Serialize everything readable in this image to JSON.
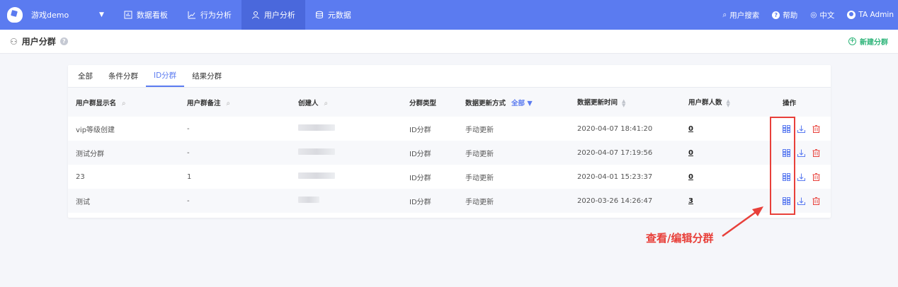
{
  "topbar": {
    "project": "游戏demo",
    "nav": [
      {
        "label": "数据看板",
        "icon": "dashboard-icon"
      },
      {
        "label": "行为分析",
        "icon": "trend-icon"
      },
      {
        "label": "用户分析",
        "icon": "user-icon"
      },
      {
        "label": "元数据",
        "icon": "database-icon"
      }
    ],
    "right": {
      "search": "用户搜索",
      "help": "帮助",
      "lang": "中文",
      "user": "TA Admin"
    }
  },
  "subheader": {
    "title": "用户分群",
    "new_button": "新建分群"
  },
  "tabs": [
    "全部",
    "条件分群",
    "ID分群",
    "结果分群"
  ],
  "active_tab": 2,
  "table": {
    "headers": {
      "name": "用户群显示名",
      "note": "用户群备注",
      "creator": "创建人",
      "type": "分群类型",
      "update_mode": "数据更新方式",
      "update_filter": "全部",
      "update_time": "数据更新时间",
      "count": "用户群人数",
      "ops": "操作"
    },
    "rows": [
      {
        "name": "vip等级创建",
        "note": "-",
        "type": "ID分群",
        "mode": "手动更新",
        "time": "2020-04-07 18:41:20",
        "count": "0"
      },
      {
        "name": "测试分群",
        "note": "-",
        "type": "ID分群",
        "mode": "手动更新",
        "time": "2020-04-07 17:19:56",
        "count": "0"
      },
      {
        "name": "23",
        "note": "1",
        "type": "ID分群",
        "mode": "手动更新",
        "time": "2020-04-01 15:23:37",
        "count": "0"
      },
      {
        "name": "测试",
        "note": "-",
        "type": "ID分群",
        "mode": "手动更新",
        "time": "2020-03-26 14:26:47",
        "count": "3"
      }
    ]
  },
  "annotation": {
    "text": "查看/编辑分群",
    "color": "#e8403a"
  },
  "colors": {
    "primary": "#5b7bf0",
    "success": "#2fb57a",
    "danger": "#e8403a"
  }
}
